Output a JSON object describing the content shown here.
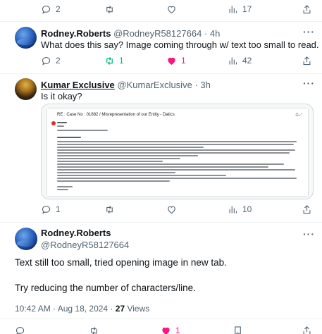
{
  "top_actions": {
    "replies": "2",
    "views": "17"
  },
  "reply_1": {
    "author": "Rodney.Roberts",
    "handle": "@RodneyR58127664",
    "time": "4h",
    "text": "What does this say? Image coming through w/ text too small to read.",
    "actions": {
      "replies": "2",
      "reposts": "1",
      "likes": "1",
      "views": "42"
    },
    "repost_color": "#00ba7c",
    "like_color": "#f91880"
  },
  "reply_2": {
    "author": "Kumar Exclusive",
    "handle": "@KumarExclusive",
    "time": "3h",
    "text": "Is it okay?",
    "actions": {
      "replies": "1",
      "views": "10"
    }
  },
  "email_preview": {
    "subject": "RE : Case No : 01882 / Misrepresentation of our Entity - Datics"
  },
  "detail": {
    "author": "Rodney.Roberts",
    "handle": "@RodneyR58127664",
    "line_1": "Text still too small, tried opening image in new tab.",
    "line_2": "Try reducing the number of characters/line.",
    "timestamp": "10:42 AM · Aug 18, 2024 · ",
    "views_count": "27",
    "views_label": " Views"
  },
  "bottom_actions": {
    "likes": "1"
  },
  "colors": {
    "text_primary": "#0f1419",
    "text_secondary": "#536471",
    "divider": "#eff3f4",
    "like": "#f91880",
    "repost": "#00ba7c"
  },
  "icons": [
    "reply-icon",
    "repost-icon",
    "like-icon",
    "views-icon",
    "bookmark-icon",
    "share-icon",
    "more-icon"
  ]
}
